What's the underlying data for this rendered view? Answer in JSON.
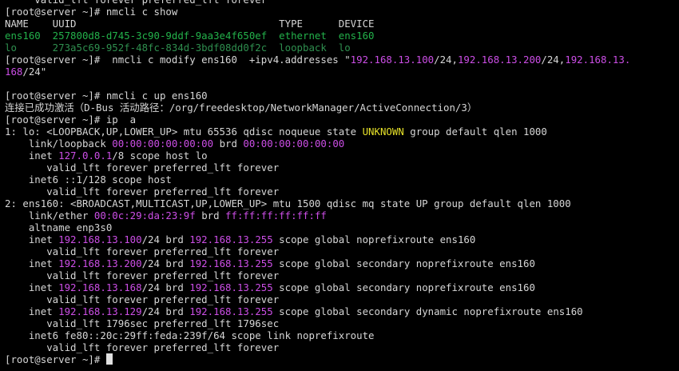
{
  "terminal": {
    "colors": {
      "background": "#000000",
      "foreground": "#d6d6d6",
      "green": "#23b24b",
      "dim_green": "#2f8f4f",
      "magenta": "#cc4ee6",
      "yellow": "#e5e029"
    },
    "lines": [
      [
        {
          "t": "     valid_lft forever preferred_lft forever"
        }
      ],
      [
        {
          "t": "[root@server ~]# nmcli c show"
        }
      ],
      [
        {
          "t": "NAME    UUID                                  TYPE      DEVICE"
        }
      ],
      [
        {
          "t": "ens160  257800d8-d745-3c90-9ddf-9aa3e4f650ef  ethernet  ens160",
          "c": "green"
        }
      ],
      [
        {
          "t": "lo      273a5c69-952f-48fc-834d-3bdf08dd0f2c  loopback  lo",
          "c": "gray"
        }
      ],
      [
        {
          "t": "[root@server ~]#  nmcli c modify ens160  +ipv4.addresses \""
        },
        {
          "t": "192.168.13.100",
          "c": "mag"
        },
        {
          "t": "/24,"
        },
        {
          "t": "192.168.13.200",
          "c": "mag"
        },
        {
          "t": "/24,"
        },
        {
          "t": "192.168.13.",
          "c": "mag"
        }
      ],
      [
        {
          "t": "168",
          "c": "mag"
        },
        {
          "t": "/24\""
        }
      ],
      [
        {
          "t": ""
        }
      ],
      [
        {
          "t": "[root@server ~]# nmcli c up ens160"
        }
      ],
      [
        {
          "t": "连接已成功激活（D-Bus 活动路径：/org/freedesktop/NetworkManager/ActiveConnection/3）"
        }
      ],
      [
        {
          "t": "[root@server ~]# ip  a"
        }
      ],
      [
        {
          "t": "1: lo: <LOOPBACK,UP,LOWER_UP> mtu 65536 qdisc noqueue state "
        },
        {
          "t": "UNKNOWN",
          "c": "yel"
        },
        {
          "t": " group default qlen 1000"
        }
      ],
      [
        {
          "t": "    link/loopback "
        },
        {
          "t": "00:00:00:00:00:00",
          "c": "mag"
        },
        {
          "t": " brd "
        },
        {
          "t": "00:00:00:00:00:00",
          "c": "mag"
        }
      ],
      [
        {
          "t": "    inet "
        },
        {
          "t": "127.0.0.1",
          "c": "mag"
        },
        {
          "t": "/8 scope host lo"
        }
      ],
      [
        {
          "t": "       valid_lft forever preferred_lft forever"
        }
      ],
      [
        {
          "t": "    inet6 ::1/128 scope host"
        }
      ],
      [
        {
          "t": "       valid_lft forever preferred_lft forever"
        }
      ],
      [
        {
          "t": "2: ens160: <BROADCAST,MULTICAST,UP,LOWER_UP> mtu 1500 qdisc mq state UP group default qlen 1000"
        }
      ],
      [
        {
          "t": "    link/ether "
        },
        {
          "t": "00:0c:29:da:23:9f",
          "c": "mag"
        },
        {
          "t": " brd "
        },
        {
          "t": "ff:ff:ff:ff:ff:ff",
          "c": "mag"
        }
      ],
      [
        {
          "t": "    altname enp3s0"
        }
      ],
      [
        {
          "t": "    inet "
        },
        {
          "t": "192.168.13.100",
          "c": "mag"
        },
        {
          "t": "/24 brd "
        },
        {
          "t": "192.168.13.255",
          "c": "mag"
        },
        {
          "t": " scope global noprefixroute ens160"
        }
      ],
      [
        {
          "t": "       valid_lft forever preferred_lft forever"
        }
      ],
      [
        {
          "t": "    inet "
        },
        {
          "t": "192.168.13.200",
          "c": "mag"
        },
        {
          "t": "/24 brd "
        },
        {
          "t": "192.168.13.255",
          "c": "mag"
        },
        {
          "t": " scope global secondary noprefixroute ens160"
        }
      ],
      [
        {
          "t": "       valid_lft forever preferred_lft forever"
        }
      ],
      [
        {
          "t": "    inet "
        },
        {
          "t": "192.168.13.168",
          "c": "mag"
        },
        {
          "t": "/24 brd "
        },
        {
          "t": "192.168.13.255",
          "c": "mag"
        },
        {
          "t": " scope global secondary noprefixroute ens160"
        }
      ],
      [
        {
          "t": "       valid_lft forever preferred_lft forever"
        }
      ],
      [
        {
          "t": "    inet "
        },
        {
          "t": "192.168.13.129",
          "c": "mag"
        },
        {
          "t": "/24 brd "
        },
        {
          "t": "192.168.13.255",
          "c": "mag"
        },
        {
          "t": " scope global secondary dynamic noprefixroute ens160"
        }
      ],
      [
        {
          "t": "       valid_lft 1796sec preferred_lft 1796sec"
        }
      ],
      [
        {
          "t": "    inet6 fe80::20c:29ff:feda:239f/64 scope link noprefixroute"
        }
      ],
      [
        {
          "t": "       valid_lft forever preferred_lft forever"
        }
      ],
      [
        {
          "t": "[root@server ~]# "
        }
      ]
    ]
  }
}
